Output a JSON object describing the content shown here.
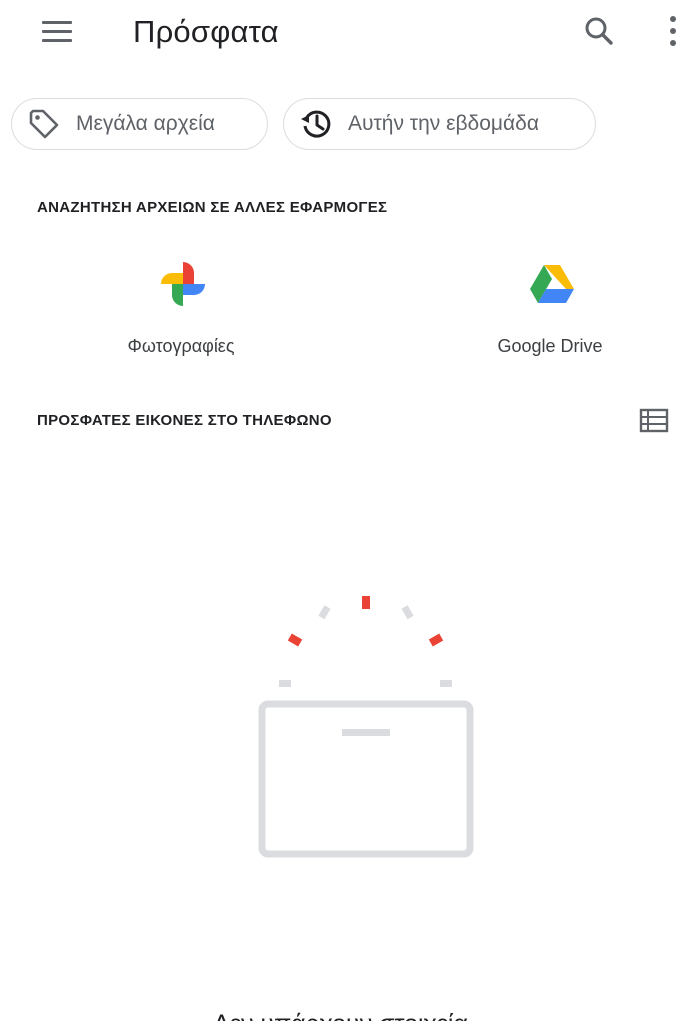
{
  "header": {
    "title": "Πρόσφατα",
    "menu_icon": "hamburger-menu-icon",
    "search_icon": "search-icon",
    "more_icon": "more-vert-icon"
  },
  "chips": [
    {
      "label": "Μεγάλα αρχεία",
      "icon": "tag-icon"
    },
    {
      "label": "Αυτήν την εβδομάδα",
      "icon": "history-icon"
    }
  ],
  "apps_section": {
    "title": "ΑΝΑΖΗΤΗΣΗ ΑΡΧΕΙΩΝ ΣΕ ΑΛΛΕΣ ΕΦΑΡΜΟΓΕΣ",
    "apps": [
      {
        "label": "Φωτογραφίες",
        "icon": "google-photos-icon"
      },
      {
        "label": "Google Drive",
        "icon": "google-drive-icon"
      }
    ]
  },
  "recent_section": {
    "title": "ΠΡΟΣΦΑΤΕΣ ΕΙΚΟΝΕΣ ΣΤΟ ΤΗΛΕΦΩΝΟ",
    "view_toggle_icon": "list-view-icon"
  },
  "empty_state": {
    "message": "Δεν υπάρχουν στοιχεία",
    "illustration": "empty-box-icon"
  },
  "colors": {
    "text_primary": "#202124",
    "text_secondary": "#5f6368",
    "chip_border": "#dadce0",
    "accent_red": "#ea4335",
    "illustration_gray": "#dadce0"
  }
}
